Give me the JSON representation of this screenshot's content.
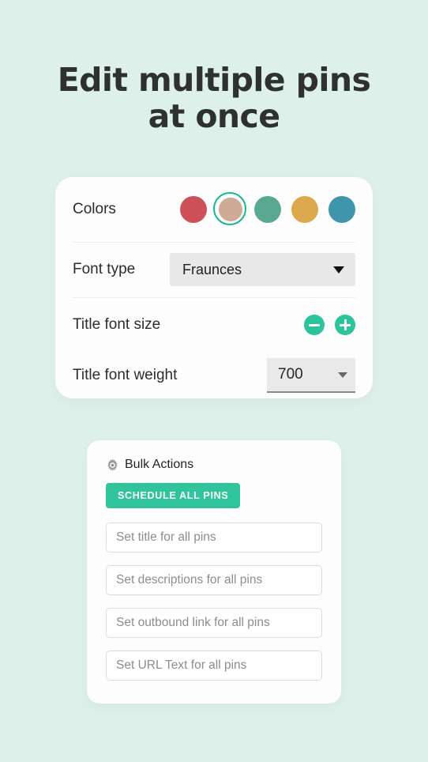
{
  "page": {
    "background_color": "#ddf1ea",
    "headline": "Edit multiple pins at once",
    "headline_line1": "Edit multiple pins",
    "headline_line2": "at once"
  },
  "settings_card": {
    "colors_row": {
      "label": "Colors",
      "swatches": [
        {
          "name": "swatch-red",
          "color": "#ce5159",
          "selected": false
        },
        {
          "name": "swatch-tan",
          "color": "#cfab97",
          "selected": true
        },
        {
          "name": "swatch-green",
          "color": "#5aa792",
          "selected": false
        },
        {
          "name": "swatch-gold",
          "color": "#dda94f",
          "selected": false
        },
        {
          "name": "swatch-blue-teal",
          "color": "#3f95ab",
          "selected": false
        }
      ],
      "selection_ring_color": "#14b98a"
    },
    "font_type_row": {
      "label": "Font type",
      "value": "Fraunces",
      "caret": "chevron-down-icon"
    },
    "title_font_size_row": {
      "label": "Title font size",
      "decrement_label": "−",
      "increment_label": "+",
      "button_color": "#2cc49a"
    },
    "title_font_weight_row": {
      "label": "Title font weight",
      "value": "700",
      "caret": "chevron-down-icon"
    }
  },
  "bulk_card": {
    "icon": "gear-icon",
    "title": "Bulk Actions",
    "schedule_button_label": "SCHEDULE ALL PINS",
    "schedule_button_color": "#30c49d",
    "inputs": [
      {
        "name": "bulk-title-input",
        "value": "",
        "placeholder": "Set title for all pins"
      },
      {
        "name": "bulk-descriptions-input",
        "value": "",
        "placeholder": "Set descriptions for all pins"
      },
      {
        "name": "bulk-outbound-link-input",
        "value": "",
        "placeholder": "Set outbound link for all pins"
      },
      {
        "name": "bulk-url-text-input",
        "value": "",
        "placeholder": "Set URL Text for all pins"
      }
    ]
  }
}
